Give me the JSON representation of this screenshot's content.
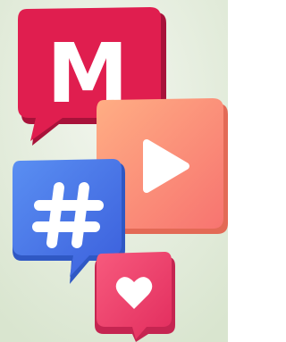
{
  "scene": {
    "background": "#e3ebd9",
    "bubbles": [
      {
        "id": "m",
        "glyph": "M",
        "icon": "m-letter-icon",
        "color": "#dd1c4d",
        "shade": "#a8123a"
      },
      {
        "id": "play",
        "icon": "play-icon",
        "color": "#fb8d72",
        "shade": "#e36a56"
      },
      {
        "id": "hash",
        "glyph": "#",
        "icon": "hashtag-icon",
        "color": "#4d79ea",
        "shade": "#2f58c4"
      },
      {
        "id": "heart",
        "icon": "heart-icon",
        "color": "#f2416e",
        "shade": "#c52551"
      }
    ],
    "glyph_color": "#ffffff"
  }
}
